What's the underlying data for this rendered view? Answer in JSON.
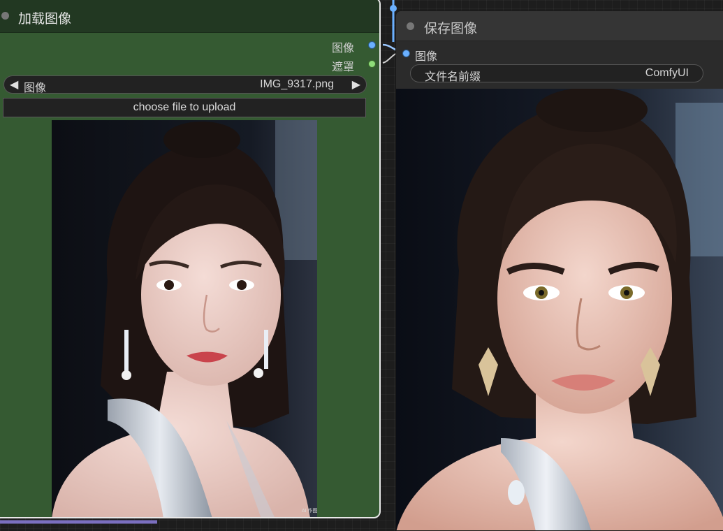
{
  "load_node": {
    "title": "加载图像",
    "outputs": {
      "image_label": "图像",
      "mask_label": "遮罩"
    },
    "image_widget": {
      "label": "图像",
      "value": "IMG_9317.png",
      "prev_icon": "◀",
      "next_icon": "▶"
    },
    "upload_button": "choose file to upload",
    "preview_watermark": "AI 作图"
  },
  "save_node": {
    "title": "保存图像",
    "inputs": {
      "image_label": "图像"
    },
    "filename_prefix": {
      "label": "文件名前缀",
      "value": "ComfyUI"
    }
  },
  "colors": {
    "load_node_body": "#355a32",
    "load_node_title": "#223822",
    "image_slot": "#6ab0ff",
    "mask_slot": "#8fdc7a",
    "canvas": "#1d1d1d"
  }
}
